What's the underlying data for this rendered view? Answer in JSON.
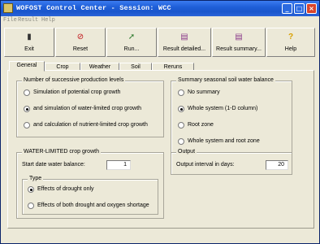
{
  "window": {
    "title": "WOFOST Control Center - Session: WCC"
  },
  "menu": {
    "items": [
      {
        "label": "File"
      },
      {
        "label": "Result"
      },
      {
        "label": "Help"
      }
    ]
  },
  "toolbar": {
    "buttons": [
      {
        "label": "Exit",
        "icon": "exit-icon"
      },
      {
        "label": "Reset",
        "icon": "reset-icon"
      },
      {
        "label": "Run...",
        "icon": "run-icon"
      },
      {
        "label": "Result detailed...",
        "icon": "result-detailed-icon"
      },
      {
        "label": "Result summary...",
        "icon": "result-summary-icon"
      },
      {
        "label": "Help",
        "icon": "help-icon"
      }
    ]
  },
  "tabs": [
    {
      "label": "General",
      "active": true
    },
    {
      "label": "Crop"
    },
    {
      "label": "Weather"
    },
    {
      "label": "Soil"
    },
    {
      "label": "Reruns"
    }
  ],
  "production_levels": {
    "title": "Number of successive production levels",
    "options": [
      {
        "label": "Simulation of potential crop growth",
        "selected": false
      },
      {
        "label": "and simulation of water-limited crop growth",
        "selected": true
      },
      {
        "label": "and calculation of nutrient-limited crop growth",
        "selected": false
      }
    ]
  },
  "soil_water_balance": {
    "title": "Summary seasonal soil water balance",
    "options": [
      {
        "label": "No summary",
        "selected": false
      },
      {
        "label": "Whole system (1-D column)",
        "selected": true
      },
      {
        "label": "Root zone",
        "selected": false
      },
      {
        "label": "Whole system and root zone",
        "selected": false
      }
    ]
  },
  "water_limited": {
    "title": "WATER-LIMITED crop growth",
    "start_date_label": "Start date water balance:",
    "start_date_value": "1",
    "type_title": "Type",
    "type_options": [
      {
        "label": "Effects of drought only",
        "selected": true
      },
      {
        "label": "Effects of both drought and oxygen shortage",
        "selected": false
      }
    ]
  },
  "output": {
    "title": "Output",
    "interval_label": "Output interval in days:",
    "interval_value": "20"
  },
  "colors": {
    "titlebar": "#1f5fd8",
    "face": "#ece9d8",
    "close_button": "#d8442a"
  }
}
